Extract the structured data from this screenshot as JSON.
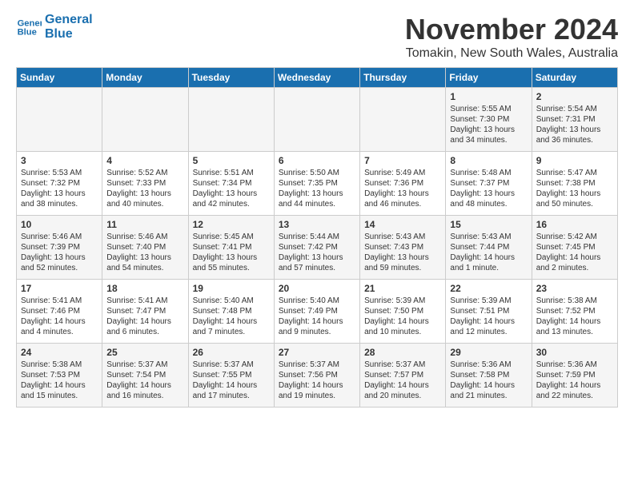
{
  "logo": {
    "line1": "General",
    "line2": "Blue"
  },
  "title": "November 2024",
  "location": "Tomakin, New South Wales, Australia",
  "weekdays": [
    "Sunday",
    "Monday",
    "Tuesday",
    "Wednesday",
    "Thursday",
    "Friday",
    "Saturday"
  ],
  "weeks": [
    [
      {
        "day": "",
        "info": ""
      },
      {
        "day": "",
        "info": ""
      },
      {
        "day": "",
        "info": ""
      },
      {
        "day": "",
        "info": ""
      },
      {
        "day": "",
        "info": ""
      },
      {
        "day": "1",
        "info": "Sunrise: 5:55 AM\nSunset: 7:30 PM\nDaylight: 13 hours and 34 minutes."
      },
      {
        "day": "2",
        "info": "Sunrise: 5:54 AM\nSunset: 7:31 PM\nDaylight: 13 hours and 36 minutes."
      }
    ],
    [
      {
        "day": "3",
        "info": "Sunrise: 5:53 AM\nSunset: 7:32 PM\nDaylight: 13 hours and 38 minutes."
      },
      {
        "day": "4",
        "info": "Sunrise: 5:52 AM\nSunset: 7:33 PM\nDaylight: 13 hours and 40 minutes."
      },
      {
        "day": "5",
        "info": "Sunrise: 5:51 AM\nSunset: 7:34 PM\nDaylight: 13 hours and 42 minutes."
      },
      {
        "day": "6",
        "info": "Sunrise: 5:50 AM\nSunset: 7:35 PM\nDaylight: 13 hours and 44 minutes."
      },
      {
        "day": "7",
        "info": "Sunrise: 5:49 AM\nSunset: 7:36 PM\nDaylight: 13 hours and 46 minutes."
      },
      {
        "day": "8",
        "info": "Sunrise: 5:48 AM\nSunset: 7:37 PM\nDaylight: 13 hours and 48 minutes."
      },
      {
        "day": "9",
        "info": "Sunrise: 5:47 AM\nSunset: 7:38 PM\nDaylight: 13 hours and 50 minutes."
      }
    ],
    [
      {
        "day": "10",
        "info": "Sunrise: 5:46 AM\nSunset: 7:39 PM\nDaylight: 13 hours and 52 minutes."
      },
      {
        "day": "11",
        "info": "Sunrise: 5:46 AM\nSunset: 7:40 PM\nDaylight: 13 hours and 54 minutes."
      },
      {
        "day": "12",
        "info": "Sunrise: 5:45 AM\nSunset: 7:41 PM\nDaylight: 13 hours and 55 minutes."
      },
      {
        "day": "13",
        "info": "Sunrise: 5:44 AM\nSunset: 7:42 PM\nDaylight: 13 hours and 57 minutes."
      },
      {
        "day": "14",
        "info": "Sunrise: 5:43 AM\nSunset: 7:43 PM\nDaylight: 13 hours and 59 minutes."
      },
      {
        "day": "15",
        "info": "Sunrise: 5:43 AM\nSunset: 7:44 PM\nDaylight: 14 hours and 1 minute."
      },
      {
        "day": "16",
        "info": "Sunrise: 5:42 AM\nSunset: 7:45 PM\nDaylight: 14 hours and 2 minutes."
      }
    ],
    [
      {
        "day": "17",
        "info": "Sunrise: 5:41 AM\nSunset: 7:46 PM\nDaylight: 14 hours and 4 minutes."
      },
      {
        "day": "18",
        "info": "Sunrise: 5:41 AM\nSunset: 7:47 PM\nDaylight: 14 hours and 6 minutes."
      },
      {
        "day": "19",
        "info": "Sunrise: 5:40 AM\nSunset: 7:48 PM\nDaylight: 14 hours and 7 minutes."
      },
      {
        "day": "20",
        "info": "Sunrise: 5:40 AM\nSunset: 7:49 PM\nDaylight: 14 hours and 9 minutes."
      },
      {
        "day": "21",
        "info": "Sunrise: 5:39 AM\nSunset: 7:50 PM\nDaylight: 14 hours and 10 minutes."
      },
      {
        "day": "22",
        "info": "Sunrise: 5:39 AM\nSunset: 7:51 PM\nDaylight: 14 hours and 12 minutes."
      },
      {
        "day": "23",
        "info": "Sunrise: 5:38 AM\nSunset: 7:52 PM\nDaylight: 14 hours and 13 minutes."
      }
    ],
    [
      {
        "day": "24",
        "info": "Sunrise: 5:38 AM\nSunset: 7:53 PM\nDaylight: 14 hours and 15 minutes."
      },
      {
        "day": "25",
        "info": "Sunrise: 5:37 AM\nSunset: 7:54 PM\nDaylight: 14 hours and 16 minutes."
      },
      {
        "day": "26",
        "info": "Sunrise: 5:37 AM\nSunset: 7:55 PM\nDaylight: 14 hours and 17 minutes."
      },
      {
        "day": "27",
        "info": "Sunrise: 5:37 AM\nSunset: 7:56 PM\nDaylight: 14 hours and 19 minutes."
      },
      {
        "day": "28",
        "info": "Sunrise: 5:37 AM\nSunset: 7:57 PM\nDaylight: 14 hours and 20 minutes."
      },
      {
        "day": "29",
        "info": "Sunrise: 5:36 AM\nSunset: 7:58 PM\nDaylight: 14 hours and 21 minutes."
      },
      {
        "day": "30",
        "info": "Sunrise: 5:36 AM\nSunset: 7:59 PM\nDaylight: 14 hours and 22 minutes."
      }
    ]
  ]
}
